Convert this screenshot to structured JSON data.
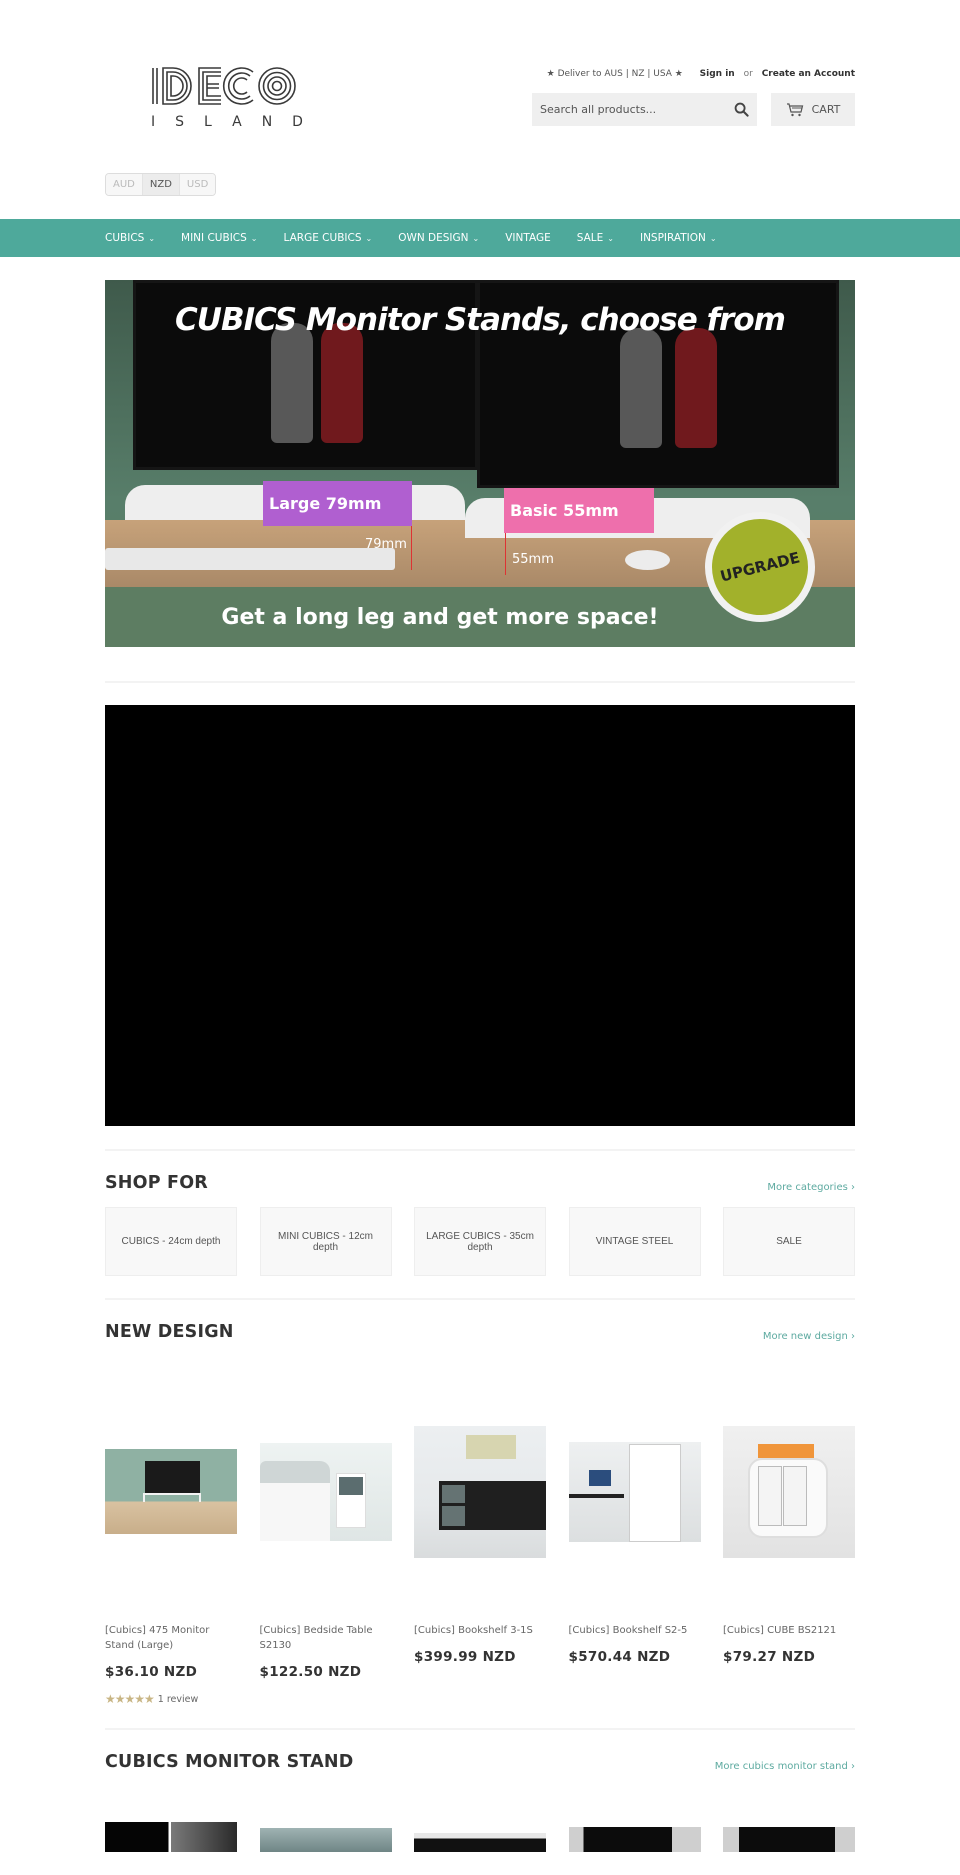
{
  "header": {
    "logo": {
      "main": "DECO",
      "sub": "ISLAND"
    },
    "deliver": "★ Deliver to AUS | NZ | USA ★",
    "sign_in": "Sign in",
    "or": "or",
    "create_account": "Create an Account",
    "search": {
      "placeholder": "Search all products...",
      "value": ""
    },
    "cart_label": "CART",
    "currency": {
      "options": [
        "AUD",
        "NZD",
        "USD"
      ],
      "selected": "NZD"
    }
  },
  "nav": {
    "items": [
      {
        "label": "CUBICS",
        "has_dropdown": true
      },
      {
        "label": "MINI CUBICS",
        "has_dropdown": true
      },
      {
        "label": "LARGE CUBICS",
        "has_dropdown": true
      },
      {
        "label": "OWN DESIGN",
        "has_dropdown": true
      },
      {
        "label": "VINTAGE",
        "has_dropdown": false
      },
      {
        "label": "SALE",
        "has_dropdown": true
      },
      {
        "label": "INSPIRATION",
        "has_dropdown": true
      }
    ],
    "bg_color": "#4ea99b"
  },
  "hero": {
    "title": "CUBICS Monitor Stands, choose from",
    "tag_large": "Large 79mm",
    "tag_basic": "Basic 55mm",
    "mm_large": "79mm",
    "mm_basic": "55mm",
    "badge": "UPGRADE",
    "tagline": "Get a long leg and get more space!",
    "colors": {
      "large": "#b05fd0",
      "basic": "#ee6fac",
      "badge": "#a2b12b",
      "band": "#5d7d62"
    }
  },
  "shop_for": {
    "title": "SHOP FOR",
    "more": "More categories ›",
    "categories": [
      "CUBICS - 24cm depth",
      "MINI CUBICS - 12cm depth",
      "LARGE CUBICS - 35cm depth",
      "VINTAGE STEEL",
      "SALE"
    ]
  },
  "new_design": {
    "title": "NEW DESIGN",
    "more": "More new design ›",
    "products": [
      {
        "name": "[Cubics] 475 Monitor Stand (Large)",
        "price": "$36.10 NZD",
        "rating": 5,
        "reviews": "1 review"
      },
      {
        "name": "[Cubics] Bedside Table S2130",
        "price": "$122.50 NZD"
      },
      {
        "name": "[Cubics] Bookshelf 3-1S",
        "price": "$399.99 NZD"
      },
      {
        "name": "[Cubics] Bookshelf S2-5",
        "price": "$570.44 NZD"
      },
      {
        "name": "[Cubics] CUBE BS2121",
        "price": "$79.27 NZD"
      }
    ]
  },
  "monitor_stand": {
    "title": "CUBICS MONITOR STAND",
    "more": "More cubics monitor stand ›"
  }
}
